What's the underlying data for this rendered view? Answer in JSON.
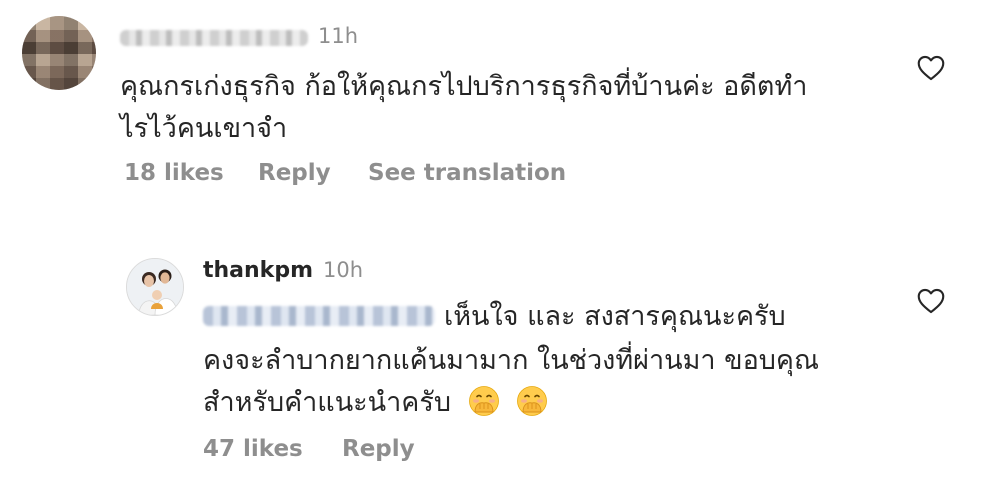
{
  "comment_1": {
    "time": "11h",
    "text_line_1": "คุณกรเก่งธุรกิจ ก้อให้คุณกรไปบริการธุรกิจที่บ้านค่ะ อดีตทำ",
    "text_line_2": "ไรไว้คนเขาจำ",
    "likes": "18 likes",
    "reply": "Reply",
    "see_translation": "See translation",
    "like_icon": "heart-outline"
  },
  "comment_2": {
    "username": "thankpm",
    "time": "10h",
    "text_line_1": "เห็นใจ และ สงสารคุณนะครับ",
    "text_line_2": "คงจะลำบากยากแค้นมามาก ในช่วงที่ผ่านมา ขอบคุณ",
    "text_line_3": "สำหรับคำแนะนำครับ",
    "emoji": "hand-over-mouth-face",
    "likes": "47 likes",
    "reply": "Reply",
    "like_icon": "heart-outline"
  }
}
